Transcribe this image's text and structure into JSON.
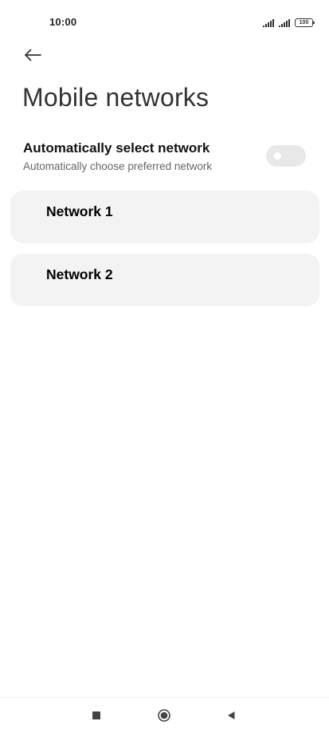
{
  "status_bar": {
    "time": "10:00",
    "battery": "100",
    "icons": [
      "signal-icon",
      "signal-icon",
      "battery-icon"
    ]
  },
  "header": {
    "back_icon": "arrow-left-icon",
    "title": "Mobile networks"
  },
  "auto_select": {
    "title": "Automatically select network",
    "subtitle": "Automatically choose preferred network",
    "enabled": false
  },
  "networks": [
    {
      "label": "Network 1"
    },
    {
      "label": "Network 2"
    }
  ],
  "nav_bar": {
    "icons": [
      "recent-apps-icon",
      "home-icon",
      "back-triangle-icon"
    ]
  },
  "colors": {
    "card_background": "#f3f3f3",
    "toggle_off": "#e8e8e8",
    "subtitle_text": "#666666",
    "title_text": "#333333"
  }
}
